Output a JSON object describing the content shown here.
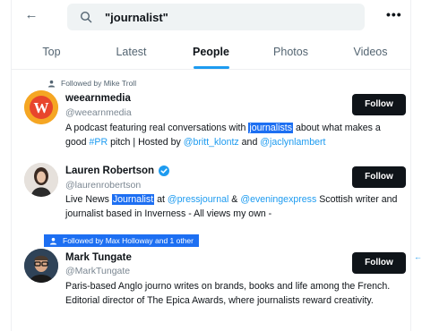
{
  "search": {
    "query": "\"journalist\""
  },
  "tabs": [
    {
      "label": "Top"
    },
    {
      "label": "Latest"
    },
    {
      "label": "People"
    },
    {
      "label": "Photos"
    },
    {
      "label": "Videos"
    }
  ],
  "active_tab": "People",
  "users": [
    {
      "social_context": "Followed by Mike Troll",
      "name": "weearnmedia",
      "handle": "@weearnmedia",
      "avatar_letter": "W",
      "follow_label": "Follow",
      "bio": {
        "p1": "A podcast featuring real conversations with ",
        "hl": "journalists",
        "p2": " about what makes a good ",
        "link1": "#PR",
        "p3": " pitch | Hosted by ",
        "link2": "@britt_klontz",
        "p4": " and ",
        "link3": "@jaclynlambert"
      }
    },
    {
      "name": "Lauren Robertson",
      "handle": "@laurenrobertson",
      "verified": true,
      "follow_label": "Follow",
      "bio": {
        "p1": "Live News ",
        "hl": "Journalist",
        "p2": " at ",
        "link1": "@pressjournal",
        "p3": " & ",
        "link2": "@eveningexpress",
        "p4": "  Scottish writer and journalist based in Inverness - All views my own -"
      }
    },
    {
      "social_context": "Followed by Max Holloway and 1 other",
      "name": "Mark Tungate",
      "handle": "@MarkTungate",
      "follow_label": "Follow",
      "bio": {
        "text": "Paris-based Anglo journo writes on brands, books and life among the French. Editorial director of The Epica Awards, where journalists reward creativity."
      }
    }
  ],
  "colors": {
    "accent": "#1d9bf0",
    "highlight": "#1d6ff2",
    "button": "#0f1419"
  }
}
